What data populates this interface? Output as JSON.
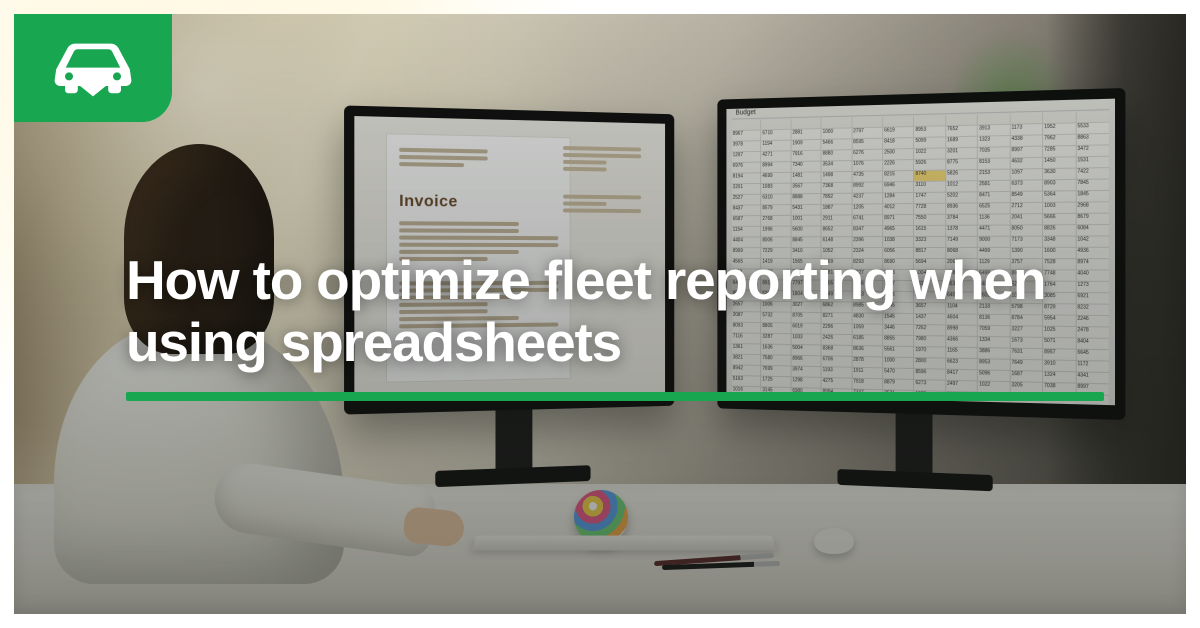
{
  "brand": {
    "accent": "#18a651",
    "icon_name": "car-icon"
  },
  "headline": "How to optimize fleet reporting when using spreadsheets",
  "left_monitor": {
    "doc_title": "Invoice"
  },
  "right_monitor": {
    "sheet_title": "Budget"
  }
}
